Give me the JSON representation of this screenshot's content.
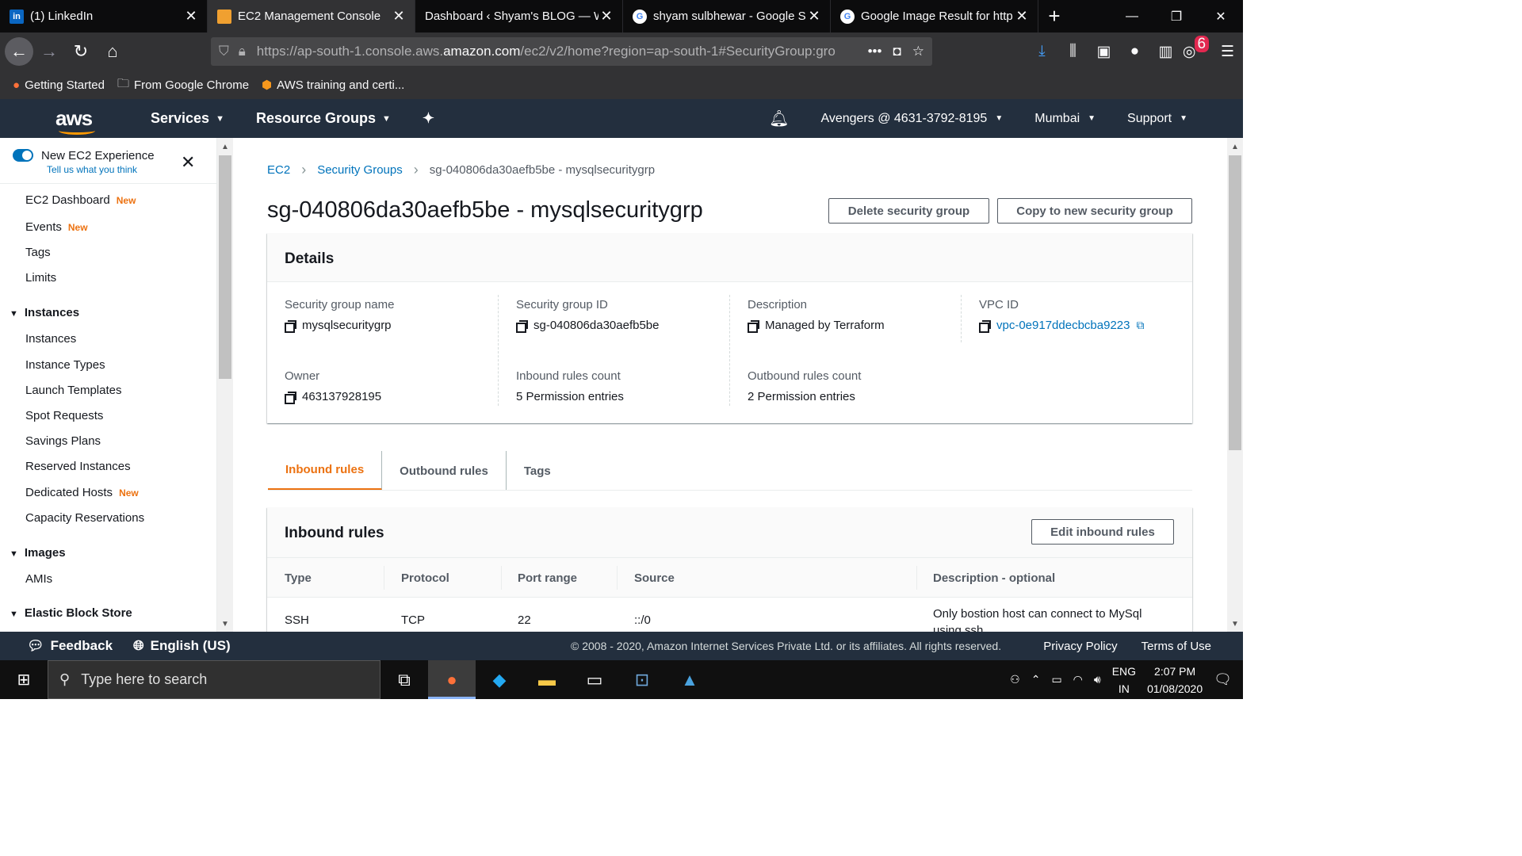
{
  "browser": {
    "tabs": [
      {
        "title": "(1) LinkedIn",
        "icon": "linkedin-icon",
        "active": false
      },
      {
        "title": "EC2 Management Console",
        "icon": "aws-box-icon",
        "active": true
      },
      {
        "title": "Dashboard ‹ Shyam's BLOG — W",
        "icon": "wordpress-icon",
        "active": false
      },
      {
        "title": "shyam sulbhewar - Google Se",
        "icon": "google-icon",
        "active": false
      },
      {
        "title": "Google Image Result for http",
        "icon": "google-icon",
        "active": false
      }
    ],
    "url_prefix": "https://ap-south-1.console.aws.",
    "url_domain": "amazon.com",
    "url_suffix": "/ec2/v2/home?region=ap-south-1#SecurityGroup:gro",
    "notification_badge": "6",
    "bookmarks": [
      {
        "label": "Getting Started",
        "icon": "firefox-icon"
      },
      {
        "label": "From Google Chrome",
        "icon": "folder-icon"
      },
      {
        "label": "AWS training and certi...",
        "icon": "aws-cube-icon"
      }
    ]
  },
  "aws_header": {
    "logo": "aws",
    "services": "Services",
    "resource_groups": "Resource Groups",
    "account": "Avengers @ 4631-3792-8195",
    "region": "Mumbai",
    "support": "Support"
  },
  "sidebar": {
    "new_experience_title": "New EC2 Experience",
    "new_experience_link": "Tell us what you think",
    "new_label": "New",
    "top_items": [
      {
        "label": "EC2 Dashboard",
        "new": true
      },
      {
        "label": "Events",
        "new": true
      },
      {
        "label": "Tags",
        "new": false
      },
      {
        "label": "Limits",
        "new": false
      }
    ],
    "instances_header": "Instances",
    "instances_items": [
      {
        "label": "Instances",
        "new": false
      },
      {
        "label": "Instance Types",
        "new": false
      },
      {
        "label": "Launch Templates",
        "new": false
      },
      {
        "label": "Spot Requests",
        "new": false
      },
      {
        "label": "Savings Plans",
        "new": false
      },
      {
        "label": "Reserved Instances",
        "new": false
      },
      {
        "label": "Dedicated Hosts",
        "new": true
      },
      {
        "label": "Capacity Reservations",
        "new": false
      }
    ],
    "images_header": "Images",
    "images_items": [
      {
        "label": "AMIs"
      }
    ],
    "ebs_header": "Elastic Block Store"
  },
  "main": {
    "breadcrumb": [
      "EC2",
      "Security Groups",
      "sg-040806da30aefb5be - mysqlsecuritygrp"
    ],
    "title": "sg-040806da30aefb5be - mysqlsecuritygrp",
    "delete_button": "Delete security group",
    "copy_button": "Copy to new security group",
    "details": {
      "heading": "Details",
      "security_group_name_label": "Security group name",
      "security_group_name": "mysqlsecuritygrp",
      "security_group_id_label": "Security group ID",
      "security_group_id": "sg-040806da30aefb5be",
      "description_label": "Description",
      "description": "Managed by Terraform",
      "vpc_id_label": "VPC ID",
      "vpc_id": "vpc-0e917ddecbcba9223",
      "owner_label": "Owner",
      "owner": "463137928195",
      "inbound_count_label": "Inbound rules count",
      "inbound_count": "5 Permission entries",
      "outbound_count_label": "Outbound rules count",
      "outbound_count": "2 Permission entries"
    },
    "tabs": [
      "Inbound rules",
      "Outbound rules",
      "Tags"
    ],
    "inbound": {
      "heading": "Inbound rules",
      "edit_button": "Edit inbound rules",
      "columns": [
        "Type",
        "Protocol",
        "Port range",
        "Source",
        "Description - optional"
      ],
      "rows": [
        {
          "type": "SSH",
          "protocol": "TCP",
          "port_range": "22",
          "source": "::/0",
          "description": "Only bostion host can connect to MySql using ssh"
        }
      ]
    }
  },
  "footer": {
    "feedback": "Feedback",
    "language": "English (US)",
    "copyright": "© 2008 - 2020, Amazon Internet Services Private Ltd. or its affiliates. All rights reserved.",
    "privacy": "Privacy Policy",
    "terms": "Terms of Use"
  },
  "taskbar": {
    "search_placeholder": "Type here to search",
    "lang_top": "ENG",
    "lang_bottom": "IN",
    "time": "2:07 PM",
    "date": "01/08/2020"
  },
  "colors": {
    "aws_nav": "#232f3e",
    "aws_orange": "#ec7211",
    "link_blue": "#0073bb"
  }
}
